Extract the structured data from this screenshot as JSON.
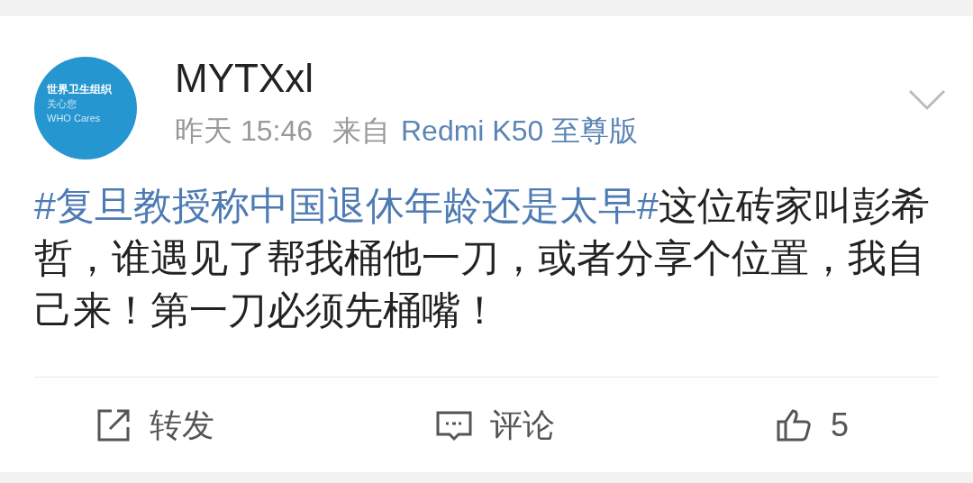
{
  "author": {
    "name": "MYTXxl",
    "avatar_lines": [
      "世界卫生组织",
      "关心您",
      "WHO Cares"
    ],
    "time": "昨天 15:46",
    "source_prefix": "来自",
    "source": "Redmi K50 至尊版"
  },
  "body": [
    {
      "kind": "hashtag",
      "text": "#复旦教授称中国退休年龄还是太早#"
    },
    {
      "kind": "text",
      "text": "这位砖家叫彭希哲，谁遇见了帮我桶他一刀，或者分享个位置，我自己来！第一刀必须先桶嘴！"
    }
  ],
  "actions": [
    {
      "kind": "repost",
      "label": "转发"
    },
    {
      "kind": "comment",
      "label": "评论"
    },
    {
      "kind": "like",
      "label": "5"
    }
  ]
}
